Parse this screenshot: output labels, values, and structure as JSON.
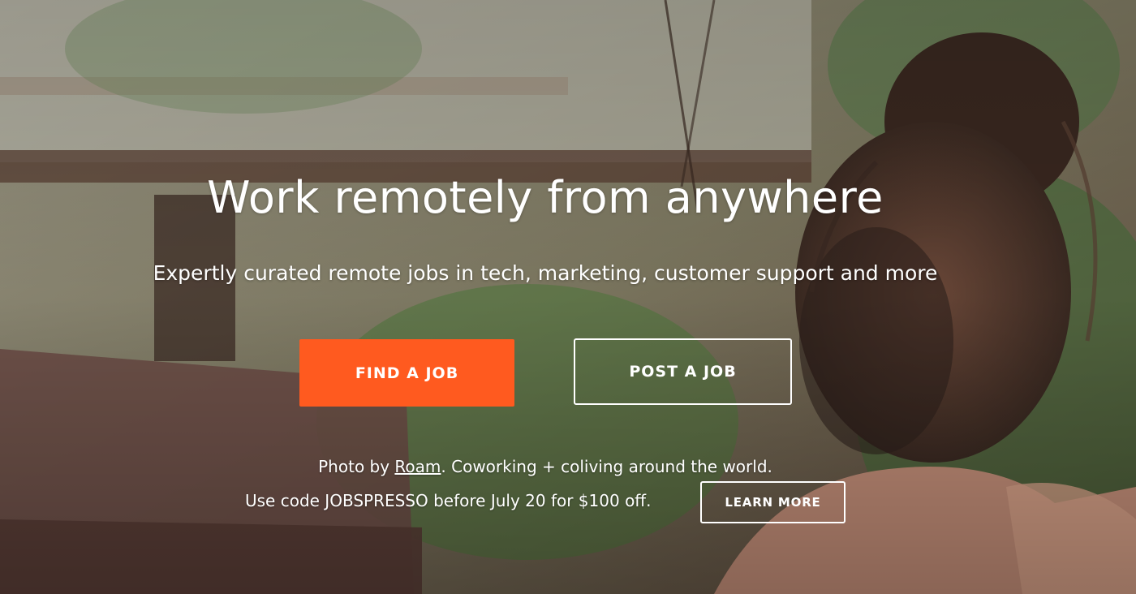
{
  "hero": {
    "headline": "Work remotely from anywhere",
    "subheadline": "Expertly curated remote jobs in tech, marketing, customer support and more",
    "primary_button": "FIND A JOB",
    "secondary_button": "POST A JOB"
  },
  "credit": {
    "prefix": "Photo by ",
    "link_text": "Roam",
    "suffix": ". Coworking + coliving around the world."
  },
  "promo": {
    "text": "Use code JOBSPRESSO before July 20 for $100 off.",
    "button": "LEARN MORE"
  },
  "colors": {
    "accent": "#ff5a1f",
    "text": "#ffffff"
  }
}
